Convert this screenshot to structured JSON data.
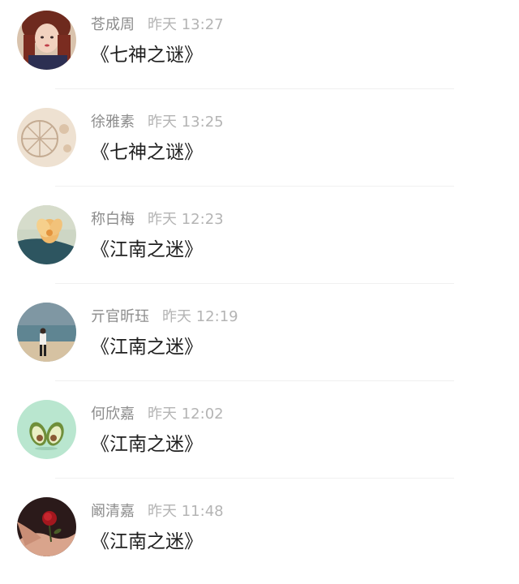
{
  "messages": [
    {
      "name": "苍成周",
      "time": "昨天 13:27",
      "text": "《七神之谜》"
    },
    {
      "name": "徐雅素",
      "time": "昨天 13:25",
      "text": "《七神之谜》"
    },
    {
      "name": "称白梅",
      "time": "昨天 12:23",
      "text": "《江南之迷》"
    },
    {
      "name": "亓官昕珏",
      "time": "昨天 12:19",
      "text": "《江南之迷》"
    },
    {
      "name": "何欣嘉",
      "time": "昨天 12:02",
      "text": "《江南之迷》"
    },
    {
      "name": "阚清嘉",
      "time": "昨天 11:48",
      "text": "《江南之迷》"
    }
  ]
}
